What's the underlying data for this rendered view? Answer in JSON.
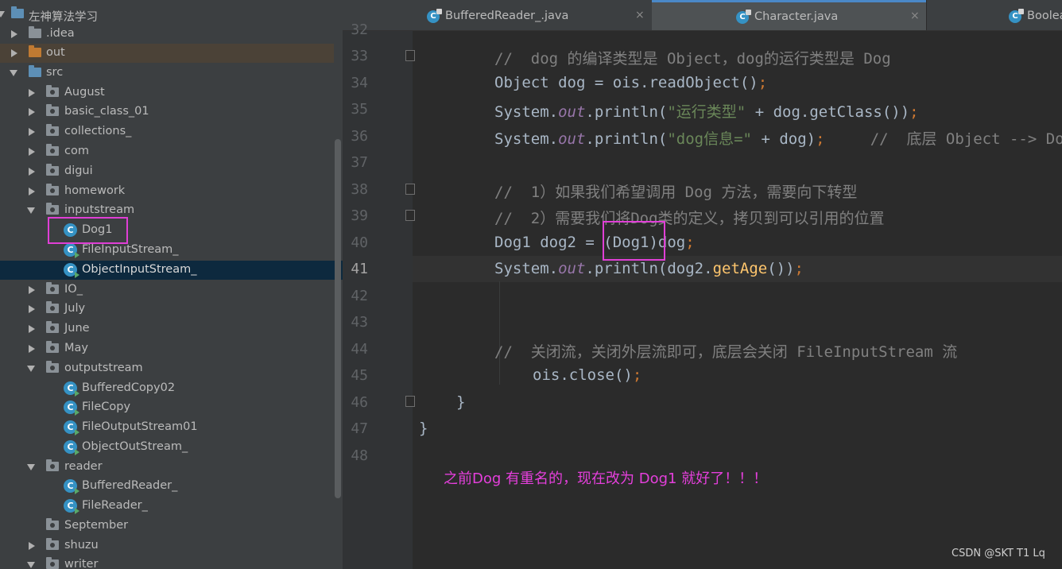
{
  "project": {
    "root": "左神算法学习",
    "items": [
      "​.idea",
      "out",
      "src",
      "August",
      "basic_class_01",
      "collections_",
      "com",
      "digui",
      "homework",
      "inputstream",
      "Dog1",
      "FileInputStream_",
      "ObjectInputStream_",
      "IO_",
      "July",
      "June",
      "May",
      "outputstream",
      "BufferedCopy02",
      "FileCopy",
      "FileOutputStream01",
      "ObjectOutStream_",
      "reader",
      "BufferedReader_",
      "FileReader_",
      "September",
      "shuzu",
      "writer"
    ]
  },
  "tabs": [
    {
      "label": "BufferedReader_.java",
      "icon": "java-class-icon",
      "close": "×"
    },
    {
      "label": "Character.java",
      "icon": "java-class-icon",
      "close": "×"
    },
    {
      "label": "Boolea",
      "icon": "java-class-icon",
      "close": ""
    }
  ],
  "editor": {
    "line_numbers": [
      "32",
      "33",
      "34",
      "35",
      "36",
      "37",
      "38",
      "39",
      "40",
      "41",
      "42",
      "43",
      "44",
      "45",
      "46",
      "47",
      "48"
    ],
    "current_line": "41"
  },
  "annotation": "之前Dog 有重名的，现在改为 Dog1 就好了！！！",
  "watermark": "CSDN @SKT T1 Lq",
  "colors": {
    "highlight_box": "#e03fd6",
    "annotation": "#e53fdc",
    "selected_row": "#0d293e"
  }
}
